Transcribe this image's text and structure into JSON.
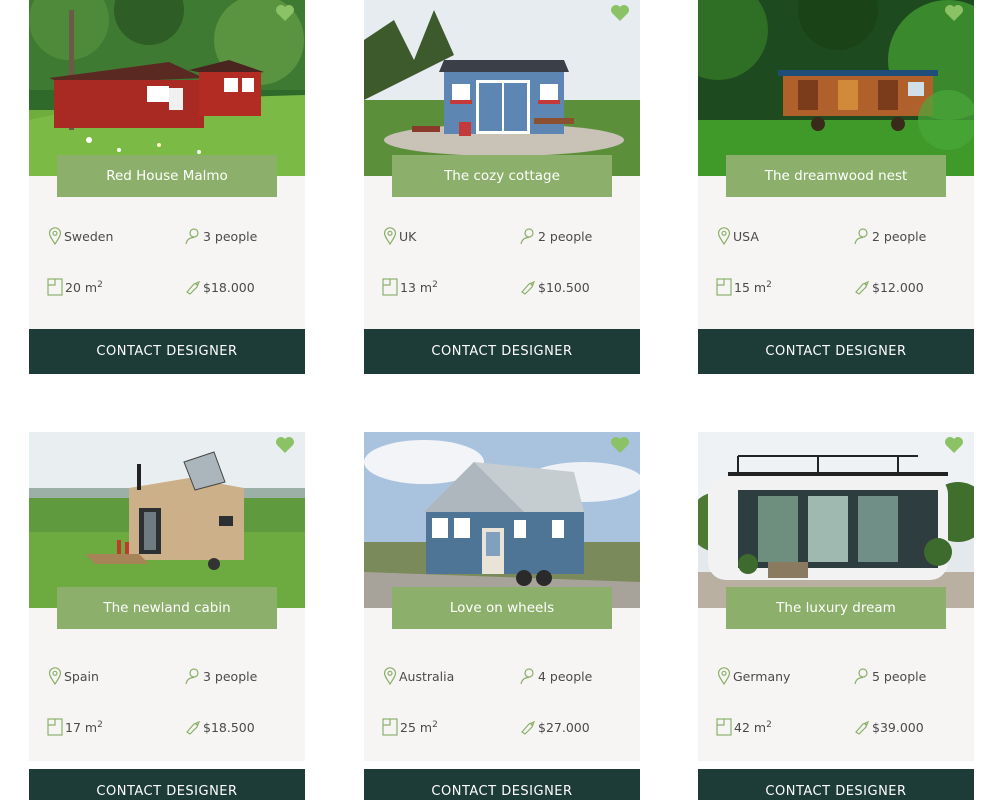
{
  "accent_color": "#8cb06b",
  "button_color": "#1d3b37",
  "heart_color": "#8cc266",
  "area_unit": "m",
  "area_unit_exponent": "2",
  "icons": {
    "location": "map-pin-icon",
    "people": "person-icon",
    "area": "floor-plan-icon",
    "price": "price-tag-icon",
    "favorite": "heart-icon"
  },
  "cards": [
    {
      "title": "Red House Malmo",
      "country": "Sweden",
      "people": "3 people",
      "area": "20",
      "price": "$18.000",
      "button": "CONTACT DESIGNER"
    },
    {
      "title": "The cozy cottage",
      "country": "UK",
      "people": "2 people",
      "area": "13",
      "price": "$10.500",
      "button": "CONTACT DESIGNER"
    },
    {
      "title": "The dreamwood nest",
      "country": "USA",
      "people": "2 people",
      "area": "15",
      "price": "$12.000",
      "button": "CONTACT DESIGNER"
    },
    {
      "title": "The newland cabin",
      "country": "Spain",
      "people": "3 people",
      "area": "17",
      "price": "$18.500",
      "button": "CONTACT DESIGNER"
    },
    {
      "title": "Love on wheels",
      "country": "Australia",
      "people": "4 people",
      "area": "25",
      "price": "$27.000",
      "button": "CONTACT DESIGNER"
    },
    {
      "title": "The luxury dream",
      "country": "Germany",
      "people": "5 people",
      "area": "42",
      "price": "$39.000",
      "button": "CONTACT DESIGNER"
    }
  ]
}
